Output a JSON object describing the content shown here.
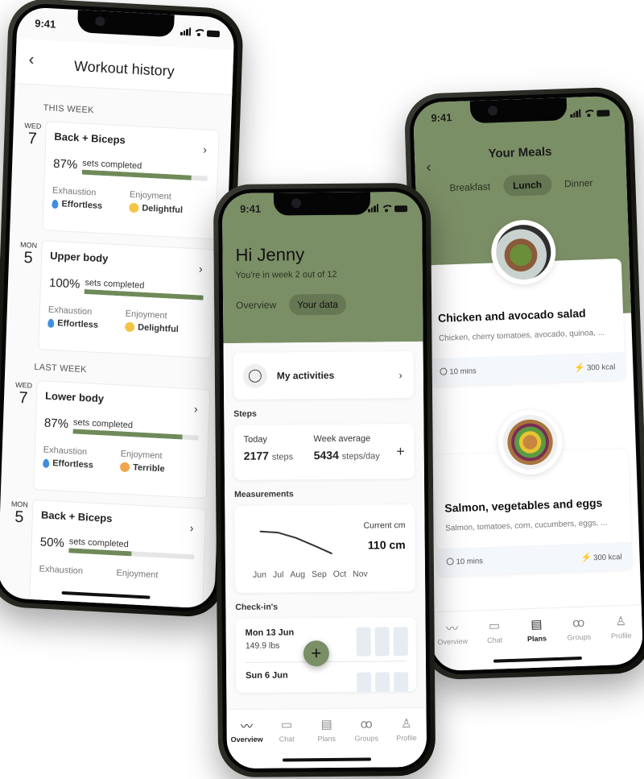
{
  "status_time": "9:41",
  "workout_history": {
    "title": "Workout history",
    "back_icon": "chevron-left-icon",
    "sections": [
      {
        "label": "THIS WEEK",
        "entries": [
          {
            "dow": "WED",
            "day": "7",
            "name": "Back + Biceps",
            "percent_label": "87%",
            "progress": 0.87,
            "sets_label": "sets completed",
            "exhaustion_label": "Exhaustion",
            "exhaustion": "Effortless",
            "enjoyment_label": "Enjoyment",
            "enjoyment": "Delightful"
          },
          {
            "dow": "MON",
            "day": "5",
            "name": "Upper body",
            "percent_label": "100%",
            "progress": 1.0,
            "sets_label": "sets completed",
            "exhaustion_label": "Exhaustion",
            "exhaustion": "Effortless",
            "enjoyment_label": "Enjoyment",
            "enjoyment": "Delightful"
          }
        ]
      },
      {
        "label": "LAST WEEK",
        "entries": [
          {
            "dow": "WED",
            "day": "7",
            "name": "Lower body",
            "percent_label": "87%",
            "progress": 0.87,
            "sets_label": "sets completed",
            "exhaustion_label": "Exhaustion",
            "exhaustion": "Effortless",
            "enjoyment_label": "Enjoyment",
            "enjoyment": "Terrible"
          },
          {
            "dow": "MON",
            "day": "5",
            "name": "Back + Biceps",
            "percent_label": "50%",
            "progress": 0.5,
            "sets_label": "sets completed",
            "exhaustion_label": "Exhaustion",
            "exhaustion": "",
            "enjoyment_label": "Enjoyment",
            "enjoyment": ""
          }
        ]
      }
    ]
  },
  "overview": {
    "greeting": "Hi Jenny",
    "subtitle": "You're in week 2 out of 12",
    "tabs": [
      {
        "label": "Overview",
        "active": false
      },
      {
        "label": "Your data",
        "active": true
      }
    ],
    "activities_label": "My activities",
    "steps": {
      "section": "Steps",
      "today_label": "Today",
      "today_value": "2177",
      "today_unit": "steps",
      "avg_label": "Week average",
      "avg_value": "5434",
      "avg_unit": "steps/day"
    },
    "measurements": {
      "section": "Measurements",
      "current_label": "Current cm",
      "current_value": "110 cm",
      "months": [
        "Jun",
        "Jul",
        "Aug",
        "Sep",
        "Oct",
        "Nov"
      ],
      "trend_values": [
        1.0,
        0.97,
        0.85,
        0.68,
        0.5
      ]
    },
    "checkins": {
      "section": "Check-in's",
      "items": [
        {
          "date": "Mon 13 Jun",
          "weight": "149.9 lbs"
        },
        {
          "date": "Sun 6 Jun",
          "weight": ""
        }
      ]
    },
    "tabbar": [
      {
        "label": "Overview",
        "icon": "trend-icon",
        "active": true
      },
      {
        "label": "Chat",
        "icon": "chat-icon",
        "active": false
      },
      {
        "label": "Plans",
        "icon": "document-icon",
        "active": false
      },
      {
        "label": "Groups",
        "icon": "groups-icon",
        "active": false
      },
      {
        "label": "Profile",
        "icon": "profile-icon",
        "active": false
      }
    ]
  },
  "meals": {
    "title": "Your Meals",
    "tabs": [
      {
        "label": "Breakfast",
        "active": false
      },
      {
        "label": "Lunch",
        "active": true
      },
      {
        "label": "Dinner",
        "active": false
      }
    ],
    "items": [
      {
        "name": "Chicken and avocado salad",
        "ingredients": "Chicken, cherry tomatoes, avocado, quinoa, ...",
        "time": "10 mins",
        "kcal": "300 kcal"
      },
      {
        "name": "Salmon, vegetables and eggs",
        "ingredients": "Salmon, tomatoes, corn, cucumbers, eggs, ...",
        "time": "10 mins",
        "kcal": "300 kcal"
      }
    ],
    "tabbar": [
      {
        "label": "Overview",
        "icon": "trend-icon",
        "active": false
      },
      {
        "label": "Chat",
        "icon": "chat-icon",
        "active": false
      },
      {
        "label": "Plans",
        "icon": "document-icon",
        "active": true
      },
      {
        "label": "Groups",
        "icon": "groups-icon",
        "active": false
      },
      {
        "label": "Profile",
        "icon": "profile-icon",
        "active": false
      }
    ]
  },
  "colors": {
    "brand_green": "#7b8f66",
    "active_pill": "#667853",
    "progress_fill": "#6e8a59",
    "kcal_bolt": "#f3b52a",
    "drop_blue": "#3f8ee2"
  }
}
